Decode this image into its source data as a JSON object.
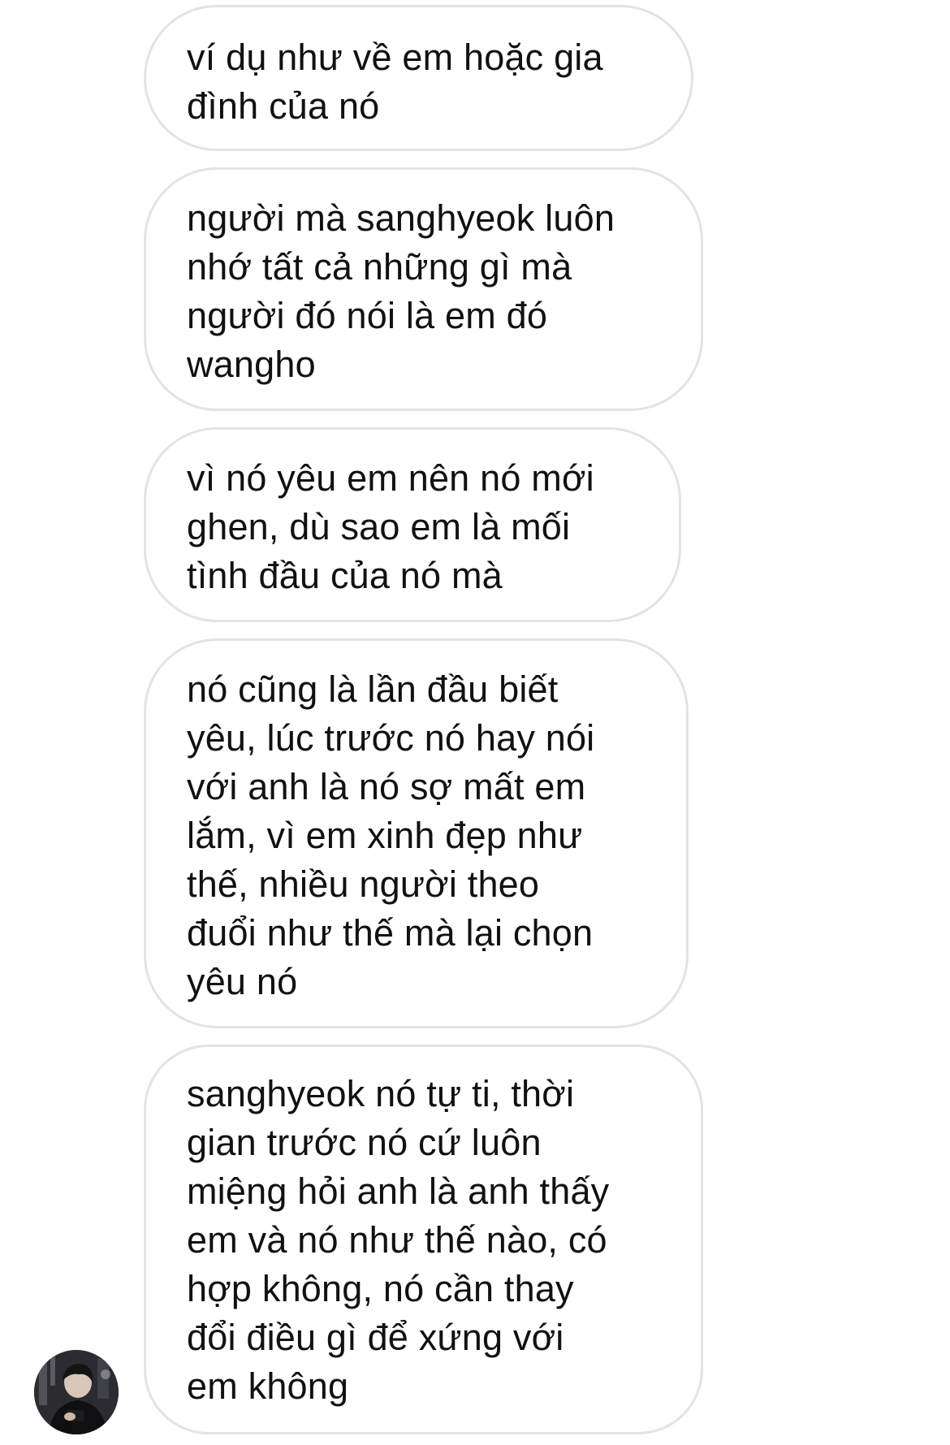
{
  "conversation": {
    "messages": [
      {
        "text": "ví dụ như về em hoặc gia\nđình của nó"
      },
      {
        "text": "người mà sanghyeok luôn\nnhớ tất cả những gì mà\nngười đó nói là em đó\nwangho"
      },
      {
        "text": "vì nó yêu em nên nó mới\nghen, dù sao em là mối\ntình đầu của nó mà"
      },
      {
        "text": "nó cũng là lần đầu biết\nyêu, lúc trước nó hay nói\nvới anh là nó sợ mất em\nlắm, vì em xinh đẹp như\nthế, nhiều người theo\nđuổi như thế mà lại chọn\nyêu nó"
      },
      {
        "text": "sanghyeok nó tự ti, thời\ngian trước nó cứ luôn\nmiệng hỏi anh là anh thấy\nem và nó như thế nào, có\nhợp không, nó cần thay\nđổi điều gì để xứng với\nem không"
      }
    ],
    "sender_avatar": {
      "icon": "user-photo-avatar"
    }
  },
  "colors": {
    "background": "#ffffff",
    "bubble_border": "#e3e3e6",
    "text": "#111111"
  }
}
